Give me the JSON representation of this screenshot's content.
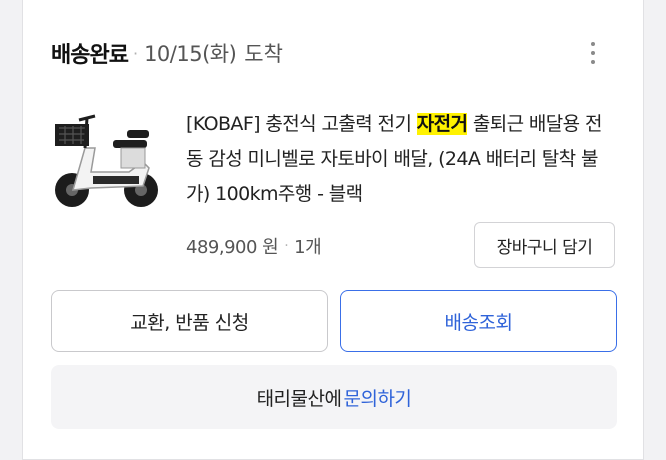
{
  "order": {
    "status": "배송완료",
    "arrival_date": "10/15(화)",
    "arrival_label": "도착"
  },
  "product": {
    "title_before": "[KOBAF] 충전식 고출력 전기 ",
    "title_highlight": "자전거",
    "title_after": " 출퇴근 배달용 전동 감성 미니벨로 자토바이 배달, (24A 배터리 탈착 불가) 100km주행 - 블랙",
    "price": "489,900 원",
    "quantity": "1개",
    "image_icon": "electric-scooter-icon",
    "highlight_color": "#fff200"
  },
  "actions": {
    "cart_label": "장바구니 담기",
    "return_label": "교환, 반품 신청",
    "track_label": "배송조회"
  },
  "inquiry": {
    "seller": "태리물산에",
    "link_label": "문의하기"
  },
  "colors": {
    "accent": "#2f63d9"
  }
}
